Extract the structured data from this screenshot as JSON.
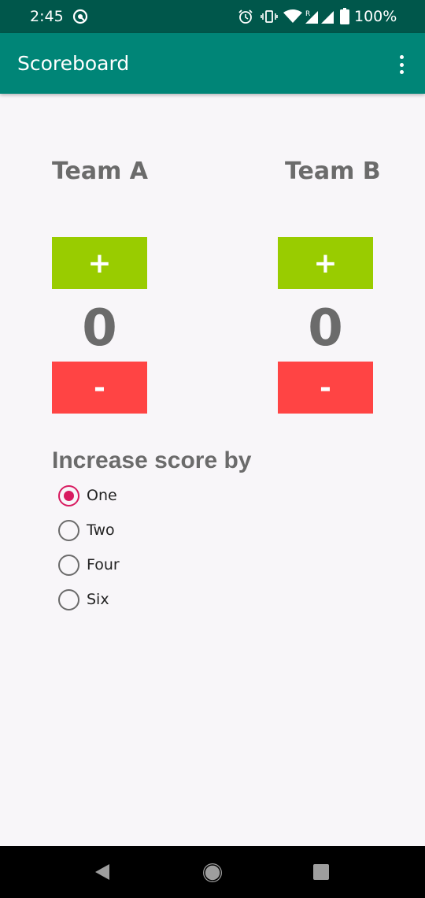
{
  "status_bar": {
    "time": "2:45",
    "battery": "100%"
  },
  "app_bar": {
    "title": "Scoreboard"
  },
  "team_a": {
    "name": "Team A",
    "plus_label": "+",
    "score": "0",
    "minus_label": "-"
  },
  "team_b": {
    "name": "Team B",
    "plus_label": "+",
    "score": "0",
    "minus_label": "-"
  },
  "increase": {
    "label": "Increase score by",
    "options": [
      {
        "label": "One",
        "checked": true
      },
      {
        "label": "Two",
        "checked": false
      },
      {
        "label": "Four",
        "checked": false
      },
      {
        "label": "Six",
        "checked": false
      }
    ]
  },
  "colors": {
    "status_bar": "#00574b",
    "app_bar": "#008577",
    "plus_button": "#99cc00",
    "minus_button": "#ff4444",
    "radio_accent": "#d81b60"
  },
  "icons": [
    "app-notification-icon",
    "alarm-icon",
    "vibrate-icon",
    "wifi-icon",
    "signal-icon",
    "battery-icon",
    "overflow-menu-icon",
    "back-icon",
    "home-icon",
    "recents-icon"
  ]
}
